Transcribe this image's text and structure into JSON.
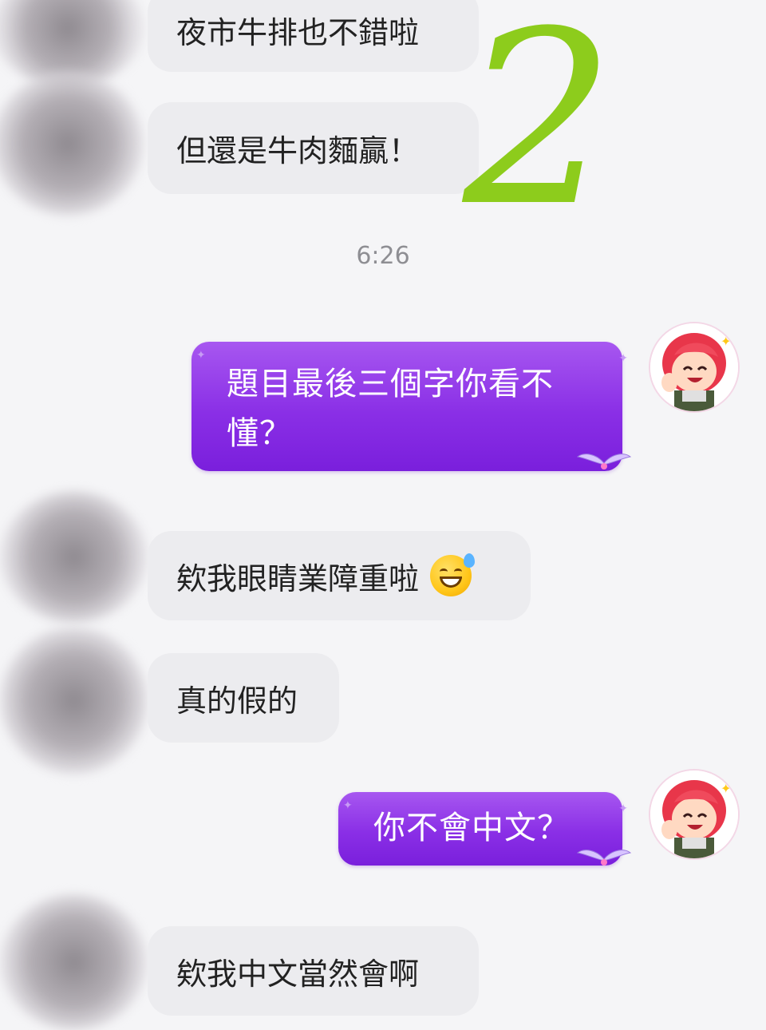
{
  "messages_top": [
    {
      "text": "夜市牛排也不錯啦"
    },
    {
      "text": "但還是牛肉麵贏！"
    }
  ],
  "overlay_number": "2",
  "timestamp": "6:26",
  "outgoing": [
    {
      "line1": "題目最後三個字你看不",
      "line2": "懂？"
    },
    {
      "text": "你不會中文？"
    }
  ],
  "incoming": [
    {
      "text": "欸我眼睛業障重啦",
      "emoji": "grinning-sweat-emoji"
    },
    {
      "text": "真的假的"
    },
    {
      "text": "欸我中文當然會啊"
    }
  ],
  "colors": {
    "outgoing_bubble": "#8a2fe6",
    "incoming_bubble": "#ececef",
    "overlay_number": "#8dcc1c"
  }
}
